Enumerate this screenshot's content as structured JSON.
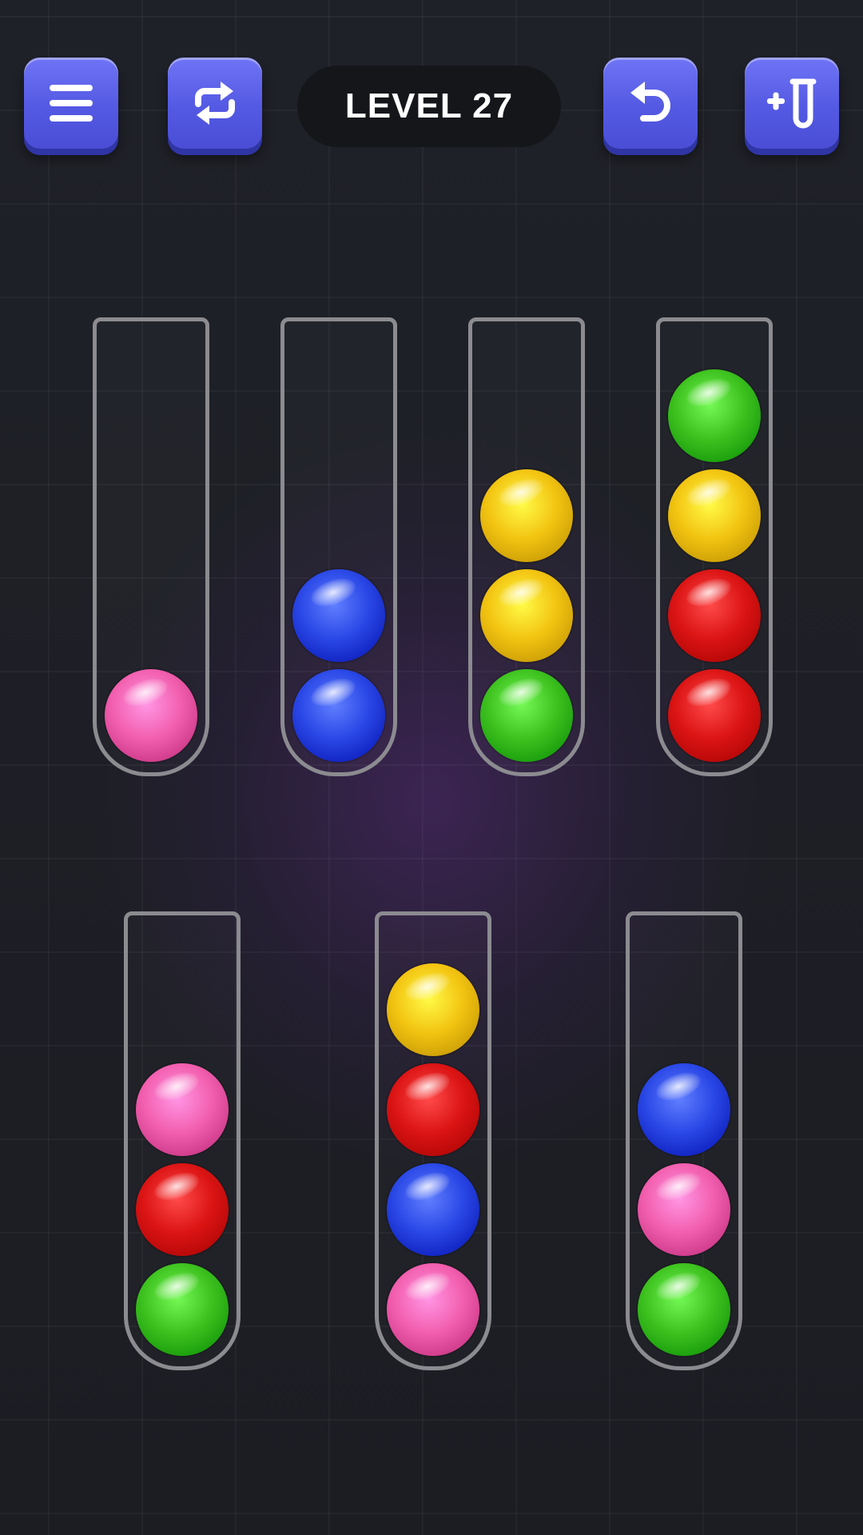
{
  "header": {
    "level_label": "LEVEL 27",
    "buttons": {
      "menu": {
        "icon": "menu-icon"
      },
      "restart": {
        "icon": "restart-icon"
      },
      "undo": {
        "icon": "undo-icon"
      },
      "add_tube": {
        "icon": "add-tube-icon"
      }
    }
  },
  "colors": {
    "pink": "#f25fae",
    "blue": "#2a48e6",
    "yellow": "#f2c411",
    "green": "#3ec21f",
    "red": "#dc1414",
    "button": "#5a5fe8",
    "tube_outline": "#8b8b90",
    "pill_bg": "#15161a"
  },
  "tubes": [
    {
      "balls": [
        "pink"
      ]
    },
    {
      "balls": [
        "blue",
        "blue"
      ]
    },
    {
      "balls": [
        "green",
        "yellow",
        "yellow"
      ]
    },
    {
      "balls": [
        "red",
        "red",
        "yellow",
        "green"
      ]
    },
    {
      "balls": [
        "green",
        "red",
        "pink"
      ]
    },
    {
      "balls": [
        "pink",
        "blue",
        "red",
        "yellow"
      ]
    },
    {
      "balls": [
        "green",
        "pink",
        "blue"
      ]
    }
  ]
}
